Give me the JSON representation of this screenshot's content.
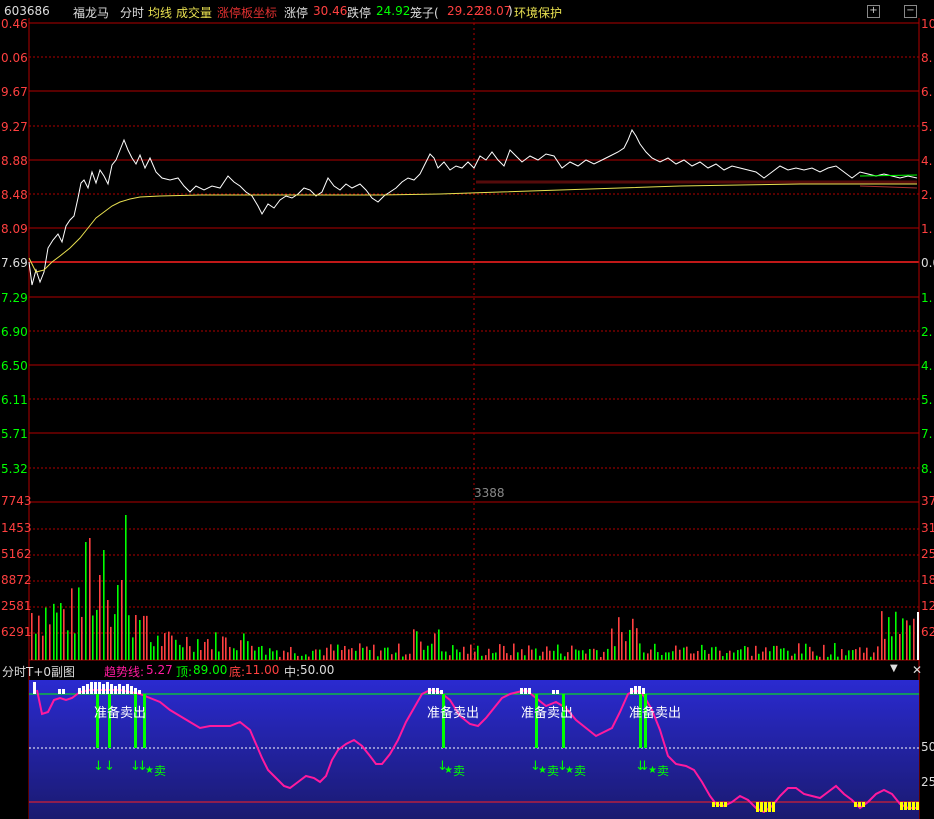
{
  "header": {
    "code": "603686",
    "name": "福龙马",
    "mode": "分时",
    "avg_label": "均线",
    "vol_label": "成交量",
    "limit_coord": "涨停板坐标",
    "limit_up_label": "涨停",
    "limit_up_value": "30.46",
    "limit_down_label": "跌停",
    "limit_down_value": "24.92",
    "cage_label": "笼子(",
    "cage_high": "29.22",
    "cage_low": "28.07",
    "cage_close": ")",
    "env_protect": "环境保护",
    "btn_plus": "+",
    "btn_minus": "−"
  },
  "price_axis": {
    "left_ticks": [
      "0.46",
      "0.06",
      "9.67",
      "9.27",
      "8.88",
      "8.48",
      "8.09",
      "7.69",
      "7.29",
      "6.90",
      "6.50",
      "6.11",
      "5.71",
      "5.32"
    ],
    "right_ticks": [
      "10",
      "8.",
      "6.",
      "5.",
      "4.",
      "2.",
      "1.",
      "0.0",
      "1.",
      "2.",
      "4.",
      "5.",
      "7.",
      "8."
    ]
  },
  "volume_axis": {
    "left_ticks": [
      "7743",
      "1453",
      "5162",
      "8872",
      "2581",
      "6291"
    ],
    "right_ticks": [
      "37",
      "31",
      "25",
      "18",
      "12",
      "62"
    ],
    "center_label": "3388"
  },
  "sub_chart": {
    "title": "分时T+0副图",
    "trend_label": "趋势线:",
    "trend_value": "5.27",
    "top_label": "顶:",
    "top_value": "89.00",
    "bottom_label": "底:",
    "bottom_value": "11.00",
    "mid_label": "中:",
    "mid_value": "50.00",
    "right_ticks": [
      "50",
      "25"
    ],
    "signal_text": "准备卖出",
    "sell_text": "卖"
  },
  "colors": {
    "bg": "#000000",
    "grid_red": "#b00000",
    "price_line": "#ffffff",
    "avg_line": "#e8e050",
    "up": "#ff4040",
    "down": "#00ff00",
    "blue_bg": "#2a2ab8",
    "trend_line": "#ff1a9e"
  }
}
